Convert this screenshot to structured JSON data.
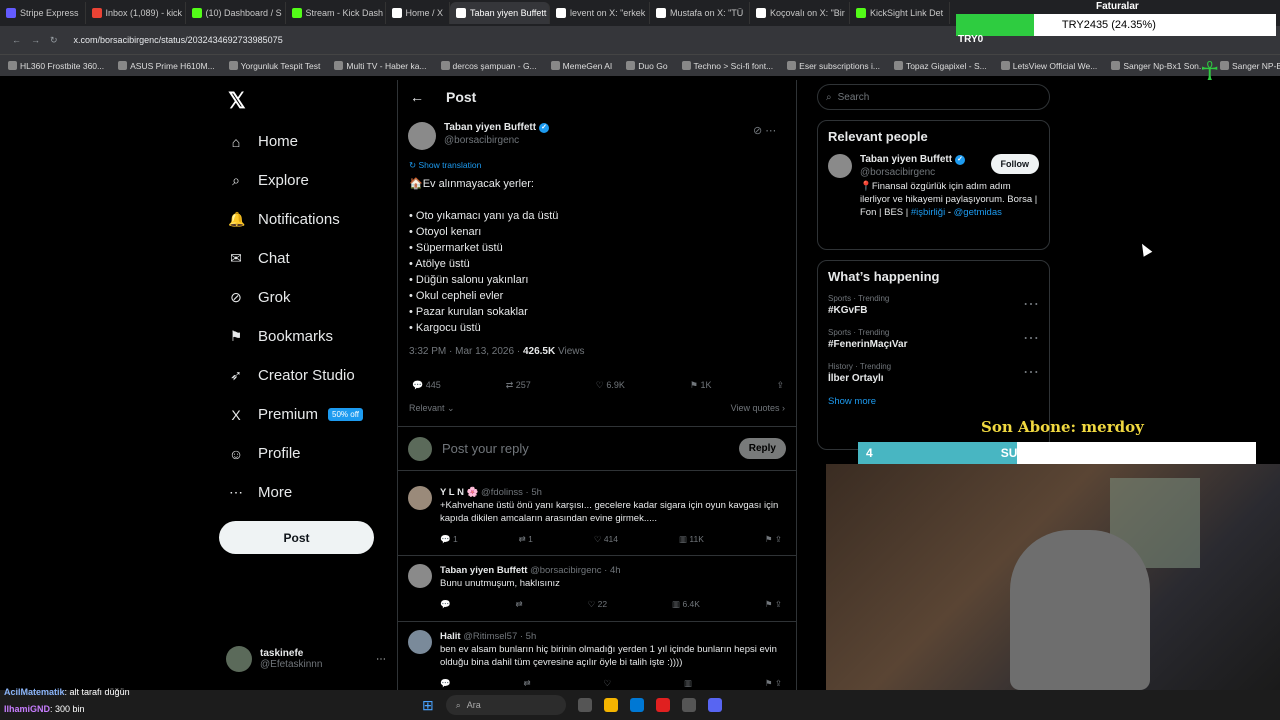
{
  "browser": {
    "tabs": [
      {
        "label": "Stripe Express",
        "color": "#635bff"
      },
      {
        "label": "Inbox (1,089) - kick",
        "color": "#ea4335"
      },
      {
        "label": "(10) Dashboard / S",
        "color": "#53fc18"
      },
      {
        "label": "Stream - Kick Dash",
        "color": "#53fc18"
      },
      {
        "label": "Home / X",
        "color": "#ffffff"
      },
      {
        "label": "Taban yiyen Buffett on X",
        "color": "#ffffff",
        "active": true
      },
      {
        "label": "levent on X: \"erkek",
        "color": "#ffffff"
      },
      {
        "label": "Mustafa on X: \"TÜ",
        "color": "#ffffff"
      },
      {
        "label": "Koçovalı on X: \"Bir",
        "color": "#ffffff"
      },
      {
        "label": "KickSight Link Det",
        "color": "#53fc18"
      }
    ],
    "url": "x.com/borsacibirgenc/status/2032434692733985075",
    "bookmarks": [
      "HL360 Frostbite 360...",
      "ASUS Prime H610M...",
      "Yorgunluk Tespit Test",
      "Multi TV - Haber ka...",
      "dercos şampuan - G...",
      "MemeGen AI",
      "Duo Go",
      "Techno > Sci-fi font...",
      "Eser subscriptions i...",
      "Topaz Gigapixel - S...",
      "LetsView Official We...",
      "Sanger Np-Bx1 Son...",
      "Sanger NP-BX1 Sa..."
    ]
  },
  "nav": {
    "items": [
      {
        "icon": "⌂",
        "label": "Home"
      },
      {
        "icon": "⌕",
        "label": "Explore"
      },
      {
        "icon": "🔔",
        "label": "Notifications"
      },
      {
        "icon": "✉",
        "label": "Chat"
      },
      {
        "icon": "⊘",
        "label": "Grok"
      },
      {
        "icon": "⚑",
        "label": "Bookmarks"
      },
      {
        "icon": "➶",
        "label": "Creator Studio"
      },
      {
        "icon": "X",
        "label": "Premium"
      },
      {
        "icon": "☺",
        "label": "Profile"
      },
      {
        "icon": "⋯",
        "label": "More"
      }
    ],
    "premium_badge": "50% off",
    "post_button": "Post",
    "account_name": "taskinefe",
    "account_handle": "@Efetaskinnn"
  },
  "post": {
    "header": "Post",
    "author_name": "Taban yiyen Buffett",
    "author_handle": "@borsacibirgenc",
    "show_translation": "Show translation",
    "lines": [
      "🏠Ev alınmayacak yerler:",
      "",
      "• Oto yıkamacı yanı ya da üstü",
      "• Otoyol kenarı",
      "• Süpermarket üstü",
      "• Atölye üstü",
      "• Düğün salonu yakınları",
      "• Okul cepheli evler",
      "• Pazar kurulan sokaklar",
      "• Kargocu üstü"
    ],
    "timestamp": "3:32 PM · Mar 13, 2026 · ",
    "views_count": "426.5K",
    "views_label": " Views",
    "replies": "445",
    "reposts": "257",
    "likes": "6.9K",
    "bookmarks": "1K",
    "relevant": "Relevant",
    "view_quotes": "View quotes",
    "reply_placeholder": "Post your reply",
    "reply_button": "Reply"
  },
  "replies": [
    {
      "name": "Y L N 🌸",
      "handle": "@fdolinss · 5h",
      "text": "+Kahvehane üstü önü yanı karşısı... gecelere kadar sigara için oyun kavgası için kapıda dikilen amcaların arasından evine girmek.....",
      "r": "1",
      "rt": "1",
      "l": "414",
      "v": "11K"
    },
    {
      "name": "Taban yiyen Buffett",
      "handle": "@borsacibirgenc · 4h",
      "text": "Bunu unutmuşum, haklısınız",
      "r": "",
      "rt": "",
      "l": "22",
      "v": "6.4K"
    },
    {
      "name": "Halit",
      "handle": "@Ritimsel57 · 5h",
      "text": "ben ev alsam bunların hiç birinin olmadığı yerden 1 yıl içinde bunların hepsi evin olduğu bina dahil tüm çevresine açılır öyle bi talih işte :))))",
      "r": "",
      "rt": "",
      "l": "",
      "v": ""
    }
  ],
  "sidebar": {
    "search_placeholder": "Search",
    "relevant_title": "Relevant people",
    "person_name": "Taban yiyen Buffett",
    "person_handle": "@borsacibirgenc",
    "follow": "Follow",
    "bio_text": "📍Finansal özgürlük için adım adım ilerliyor ve hikayemi paylaşıyorum. Borsa | Fon | BES | ",
    "bio_tag": "#işbirliği",
    "bio_sep": " - ",
    "bio_mention": "@getmidas",
    "happening_title": "What’s happening",
    "trends": [
      {
        "meta": "Sports · Trending",
        "tag": "#KGvFB"
      },
      {
        "meta": "Sports · Trending",
        "tag": "#FenerinMaçıVar"
      },
      {
        "meta": "History · Trending",
        "tag": "İlber Ortaylı"
      }
    ],
    "show_more": "Show more"
  },
  "stream": {
    "goal_text": "TRY2435 (24.35%)",
    "goal_fraction": 0.2435,
    "try_label": "TRY0",
    "faturalar": "Faturalar",
    "son_abone": "Son Abone: merdoy",
    "subs_left": "4",
    "subs_label": "SUBSCRIBERS",
    "subs_right": "10",
    "subs_fraction": 0.4,
    "chat": [
      {
        "user": "AcilMatematik",
        "msg": ": alt tarafı düğün"
      },
      {
        "user": "IlhamiGND",
        "msg": ": 300 bin"
      }
    ]
  },
  "taskbar": {
    "search": "Ara"
  }
}
